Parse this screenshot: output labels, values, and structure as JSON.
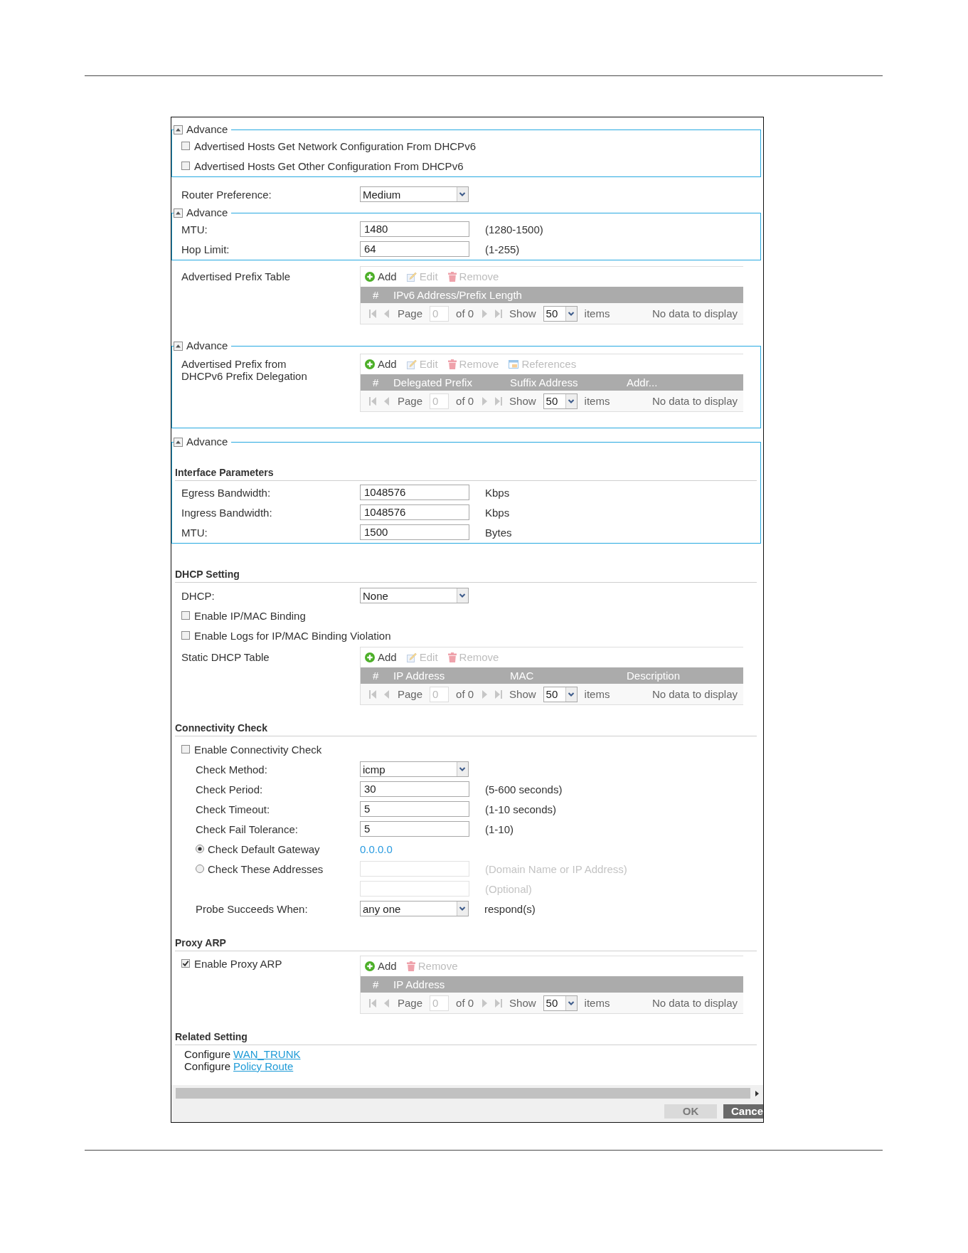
{
  "blocks": [
    {
      "kind": "advance",
      "legend": "Advance",
      "expanded": true,
      "rows": [
        {
          "kind": "checkbox",
          "label": "Advertised Hosts Get Network Configuration From DHCPv6",
          "checked": false
        },
        {
          "kind": "checkbox",
          "label": "Advertised Hosts Get Other Configuration From DHCPv6",
          "checked": false
        }
      ]
    },
    {
      "kind": "plain",
      "rows": [
        {
          "kind": "select",
          "label": "Router Preference:",
          "value": "Medium"
        }
      ]
    },
    {
      "kind": "advance",
      "legend": "Advance",
      "expanded": true,
      "rows": [
        {
          "kind": "input",
          "label": "MTU:",
          "value": "1480",
          "unit": "(1280-1500)",
          "disabled": false
        },
        {
          "kind": "input",
          "label": "Hop Limit:",
          "value": "64",
          "unit": "(1-255)",
          "disabled": false
        }
      ]
    },
    {
      "kind": "plain",
      "rows": [
        {
          "kind": "table",
          "label": "Advertised Prefix Table",
          "table": {
            "toolbar": [
              {
                "kind": "add",
                "label": "Add",
                "disabled": false
              },
              {
                "kind": "edit",
                "label": "Edit",
                "disabled": true
              },
              {
                "kind": "remove",
                "label": "Remove",
                "disabled": true
              }
            ],
            "columns": [
              "#",
              "IPv6 Address/Prefix Length"
            ],
            "pager": {
              "page_label": "Page",
              "page": "0",
              "of": "of 0",
              "show": "Show",
              "per_page": "50",
              "items": "items",
              "status": "No data to display"
            }
          }
        }
      ]
    },
    {
      "kind": "advance",
      "legend": "Advance",
      "expanded": true,
      "rows": [
        {
          "kind": "table",
          "label": "Advertised Prefix from DHCPv6 Prefix Delegation",
          "table": {
            "toolbar": [
              {
                "kind": "add",
                "label": "Add",
                "disabled": false
              },
              {
                "kind": "edit",
                "label": "Edit",
                "disabled": true
              },
              {
                "kind": "remove",
                "label": "Remove",
                "disabled": true
              },
              {
                "kind": "references",
                "label": "References",
                "disabled": true
              }
            ],
            "columns": [
              "#",
              "Delegated Prefix",
              "Suffix Address",
              "Addr..."
            ],
            "pager": {
              "page_label": "Page",
              "page": "0",
              "of": "of 0",
              "show": "Show",
              "per_page": "50",
              "items": "items",
              "status": "No data to display"
            }
          }
        }
      ]
    },
    {
      "kind": "advance",
      "legend": "Advance",
      "expanded": true,
      "rows": [
        {
          "kind": "header",
          "label": "Interface Parameters"
        },
        {
          "kind": "input",
          "label": "Egress Bandwidth:",
          "value": "1048576",
          "unit": "Kbps",
          "disabled": false
        },
        {
          "kind": "input",
          "label": "Ingress Bandwidth:",
          "value": "1048576",
          "unit": "Kbps",
          "disabled": false
        },
        {
          "kind": "input",
          "label": "MTU:",
          "value": "1500",
          "unit": "Bytes",
          "disabled": false
        }
      ]
    },
    {
      "kind": "section",
      "title": "DHCP Setting",
      "rows": [
        {
          "kind": "select",
          "label": "DHCP:",
          "value": "None"
        },
        {
          "kind": "checkbox",
          "label": "Enable IP/MAC Binding",
          "checked": false
        },
        {
          "kind": "checkbox",
          "label": "Enable Logs for IP/MAC Binding Violation",
          "checked": false
        },
        {
          "kind": "table",
          "label": "Static DHCP Table",
          "table": {
            "toolbar": [
              {
                "kind": "add",
                "label": "Add",
                "disabled": false
              },
              {
                "kind": "edit",
                "label": "Edit",
                "disabled": true
              },
              {
                "kind": "remove",
                "label": "Remove",
                "disabled": true
              }
            ],
            "columns": [
              "#",
              "IP Address",
              "MAC",
              "Description"
            ],
            "pager": {
              "page_label": "Page",
              "page": "0",
              "of": "of 0",
              "show": "Show",
              "per_page": "50",
              "items": "items",
              "status": "No data to display"
            }
          }
        }
      ]
    },
    {
      "kind": "section",
      "title": "Connectivity Check",
      "rows": [
        {
          "kind": "checkbox",
          "label": "Enable Connectivity Check",
          "checked": false,
          "children": [
            {
              "kind": "select",
              "label": "Check Method:",
              "value": "icmp"
            },
            {
              "kind": "input",
              "label": "Check Period:",
              "value": "30",
              "unit": "(5-600 seconds)",
              "disabled": false
            },
            {
              "kind": "input",
              "label": "Check Timeout:",
              "value": "5",
              "unit": "(1-10 seconds)",
              "disabled": false
            },
            {
              "kind": "input",
              "label": "Check Fail Tolerance:",
              "value": "5",
              "unit": "(1-10)",
              "disabled": false
            },
            {
              "kind": "radio",
              "label": "Check Default Gateway",
              "selected": true,
              "value": "0.0.0.0"
            },
            {
              "kind": "radio",
              "label": "Check These Addresses",
              "selected": false,
              "input": {
                "disabled": true,
                "unit": "(Domain Name or IP Address)"
              }
            },
            {
              "kind": "input",
              "unit": "(Optional)",
              "disabled": true
            },
            {
              "kind": "select",
              "label": "Probe Succeeds When:",
              "value": "any one",
              "unit": "respond(s)"
            }
          ]
        }
      ]
    },
    {
      "kind": "section",
      "title": "Proxy ARP",
      "rows": [
        {
          "kind": "checkbox",
          "label": "Enable Proxy ARP",
          "checked": true,
          "table": {
            "toolbar": [
              {
                "kind": "add",
                "label": "Add",
                "disabled": false
              },
              {
                "kind": "remove",
                "label": "Remove",
                "disabled": true
              }
            ],
            "columns": [
              "#",
              "IP Address"
            ],
            "pager": {
              "page_label": "Page",
              "page": "0",
              "of": "of 0",
              "show": "Show",
              "per_page": "50",
              "items": "items",
              "status": "No data to display"
            }
          }
        }
      ]
    },
    {
      "kind": "section",
      "title": "Related Setting",
      "rows": [
        {
          "kind": "link",
          "text": "Configure",
          "link": "WAN_TRUNK"
        },
        {
          "kind": "link",
          "text": "Configure",
          "link": "Policy Route"
        }
      ]
    }
  ],
  "buttons": [
    {
      "label": "OK",
      "disabled": true
    },
    {
      "label": "Cance",
      "disabled": false
    }
  ]
}
